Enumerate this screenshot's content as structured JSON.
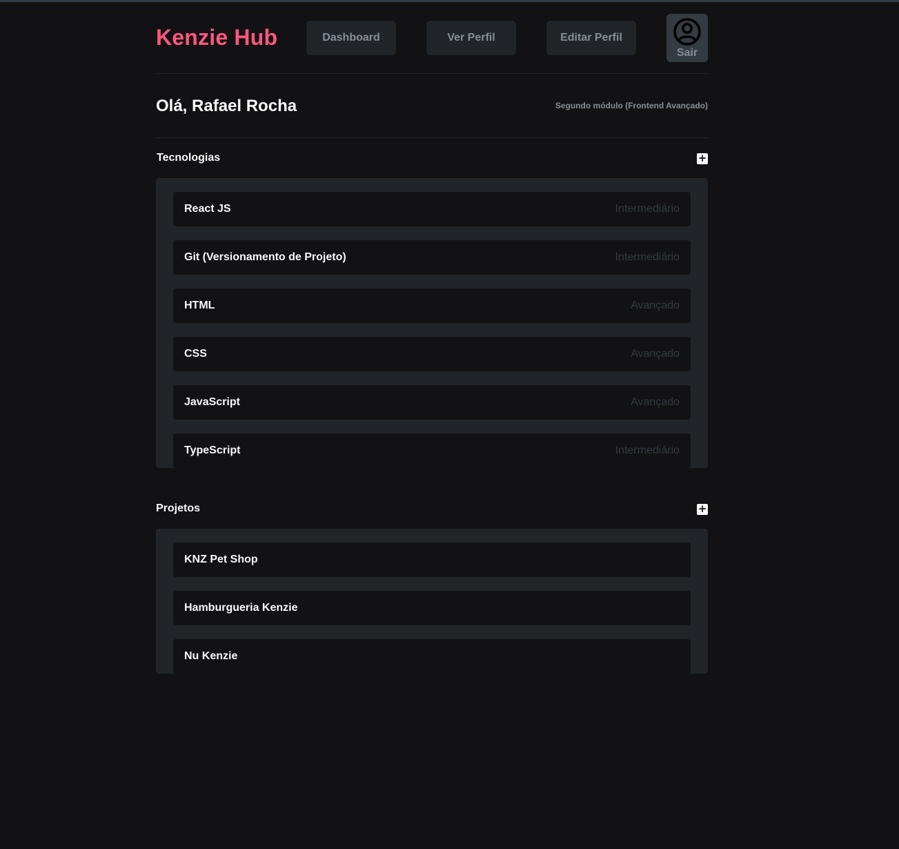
{
  "header": {
    "brand": "Kenzie Hub",
    "nav": [
      {
        "label": "Dashboard"
      },
      {
        "label": "Ver Perfil"
      },
      {
        "label": "Editar Perfil"
      }
    ],
    "logout_label": "Sair",
    "logout_icon": "user-circle-icon"
  },
  "greeting": {
    "title": "Olá, Rafael Rocha",
    "module": "Segundo módulo (Frontend Avançado)"
  },
  "technologies": {
    "title": "Tecnologias",
    "add_icon": "plus-icon",
    "add_symbol": "+",
    "items": [
      {
        "name": "React JS",
        "level": "Intermediário"
      },
      {
        "name": "Git (Versionamento de Projeto)",
        "level": "Intermediário"
      },
      {
        "name": "HTML",
        "level": "Avançado"
      },
      {
        "name": "CSS",
        "level": "Avançado"
      },
      {
        "name": "JavaScript",
        "level": "Avançado"
      },
      {
        "name": "TypeScript",
        "level": "Intermediário"
      }
    ]
  },
  "projects": {
    "title": "Projetos",
    "add_icon": "plus-icon",
    "add_symbol": "+",
    "items": [
      {
        "name": "KNZ Pet Shop"
      },
      {
        "name": "Hamburgueria Kenzie"
      },
      {
        "name": "Nu Kenzie"
      }
    ]
  },
  "colors": {
    "brand": "#FF577F",
    "background": "#121214",
    "card": "#212529",
    "button": "#343B41",
    "muted_text": "#868E96"
  }
}
